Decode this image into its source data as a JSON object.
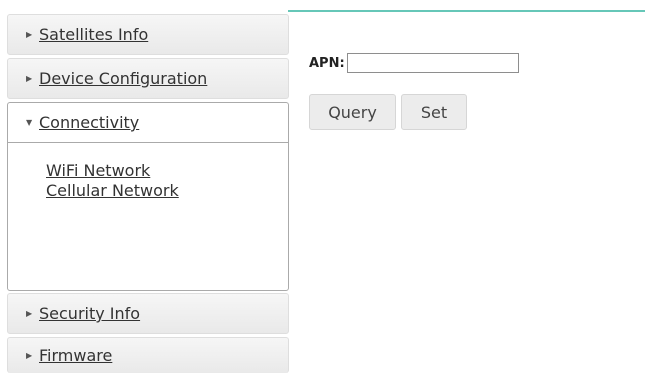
{
  "sidebar": {
    "items": [
      {
        "label": "Satellites Info",
        "icon": "triangle-right-icon",
        "expanded": false
      },
      {
        "label": "Device Configuration",
        "icon": "triangle-right-icon",
        "expanded": false
      },
      {
        "label": "Connectivity",
        "icon": "triangle-down-icon",
        "expanded": true,
        "children": [
          "WiFi Network",
          "Cellular Network"
        ]
      },
      {
        "label": "Security Info",
        "icon": "triangle-right-icon",
        "expanded": false
      },
      {
        "label": "Firmware",
        "icon": "triangle-right-icon",
        "expanded": false
      }
    ]
  },
  "main": {
    "apn_label": "APN:",
    "apn_value": "",
    "query_label": "Query",
    "set_label": "Set"
  },
  "colors": {
    "accent_line": "#66c7b8",
    "header_bg": "#ededed",
    "button_bg": "#ececec"
  }
}
